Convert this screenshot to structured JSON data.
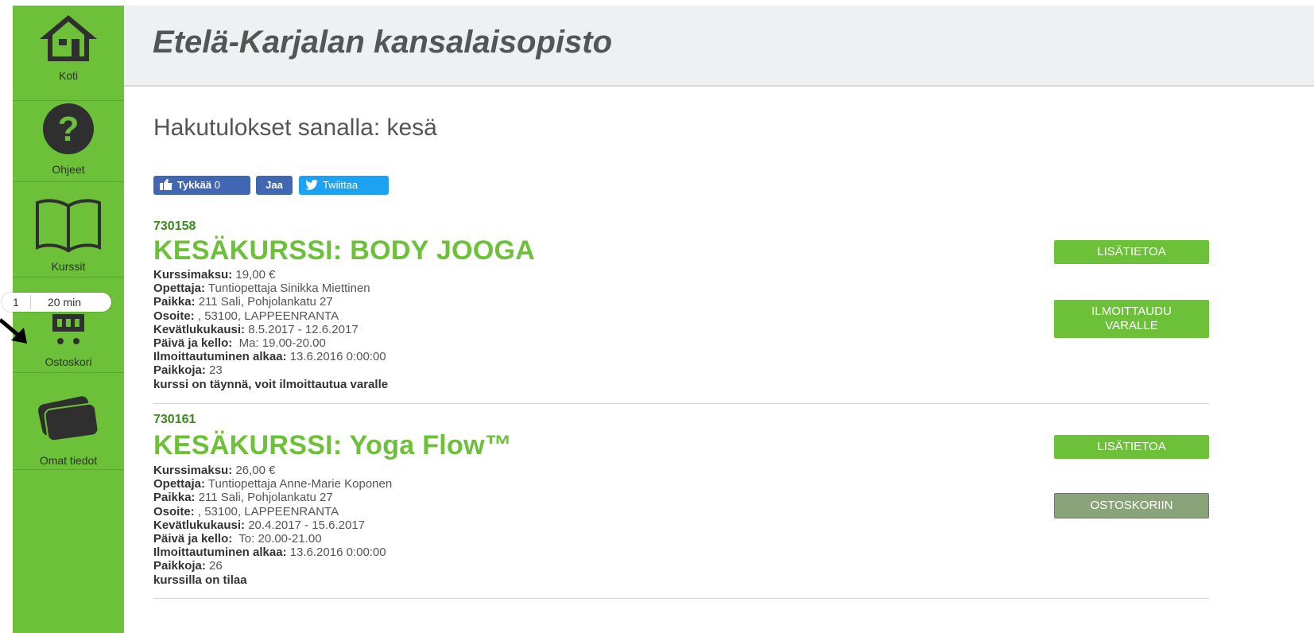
{
  "sidebar": {
    "items": [
      {
        "label": "Koti",
        "icon": "home-icon"
      },
      {
        "label": "Ohjeet",
        "icon": "help-icon"
      },
      {
        "label": "Kurssit",
        "icon": "book-icon"
      },
      {
        "label": "Ostoskori",
        "icon": "cart-icon"
      },
      {
        "label": "Omat tiedot",
        "icon": "user-card-icon"
      }
    ],
    "cart_count": "1",
    "cart_time": "20 min"
  },
  "header": {
    "title": "Etelä-Karjalan kansalaisopisto"
  },
  "search": {
    "heading": "Hakutulokset sanalla: kesä"
  },
  "social": {
    "like_label": "Tykkää",
    "like_count": "0",
    "share_label": "Jaa",
    "tweet_label": "Twiittaa"
  },
  "courses": [
    {
      "id": "730158",
      "title": "KESÄKURSSI: BODY JOOGA",
      "fee_label": "Kurssimaksu:",
      "fee": " 19,00 €",
      "teacher_label": "Opettaja:",
      "teacher": " Tuntiopettaja Sinikka Miettinen",
      "place_label": "Paikka:",
      "place": " 211 Sali, Pohjolankatu 27",
      "address_label": "Osoite:",
      "address": " , 53100, LAPPEENRANTA",
      "term_label": "Kevätlukukausi:",
      "term": " 8.5.2017 - 12.6.2017",
      "time_label": "Päivä ja kello:",
      "time": "  Ma: 19.00-20.00",
      "reg_label": "Ilmoittautuminen alkaa:",
      "reg": " 13.6.2016 0:00:00",
      "seats_label": "Paikkoja:",
      "seats": " 23",
      "status": "kurssi on täynnä, voit ilmoittautua varalle",
      "info_button": "LISÄTIETOA",
      "action_button": "ILMOITTAUDU VARALLE"
    },
    {
      "id": "730161",
      "title": "KESÄKURSSI: Yoga Flow™",
      "fee_label": "Kurssimaksu:",
      "fee": " 26,00 €",
      "teacher_label": "Opettaja:",
      "teacher": " Tuntiopettaja Anne-Marie Koponen",
      "place_label": "Paikka:",
      "place": " 211 Sali, Pohjolankatu 27",
      "address_label": "Osoite:",
      "address": " , 53100, LAPPEENRANTA",
      "term_label": "Kevätlukukausi:",
      "term": " 20.4.2017 - 15.6.2017",
      "time_label": "Päivä ja kello:",
      "time": "  To: 20.00-21.00",
      "reg_label": "Ilmoittautuminen alkaa:",
      "reg": " 13.6.2016 0:00:00",
      "seats_label": "Paikkoja:",
      "seats": " 26",
      "status": "kurssilla on tilaa",
      "info_button": "LISÄTIETOA",
      "action_button": "OSTOSKORIIN"
    }
  ],
  "colors": {
    "brand_green": "#6cc138",
    "facebook_blue": "#4267b2",
    "twitter_blue": "#1da1f2",
    "cart_button": "#8aa37a"
  }
}
